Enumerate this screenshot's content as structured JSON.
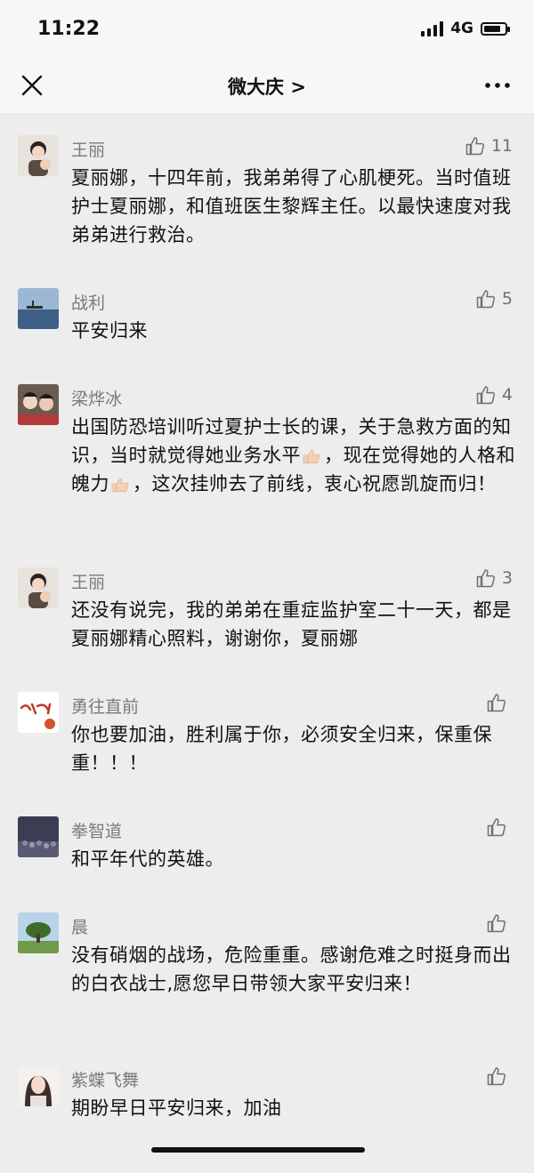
{
  "status": {
    "time": "11:22",
    "network": "4G"
  },
  "nav": {
    "title": "微大庆 >",
    "close_icon": "close-icon",
    "more_icon": "more-icon"
  },
  "comments": [
    {
      "name": "王丽",
      "likes": "11",
      "avatar": "avatar-woman-child",
      "text": "夏丽娜，十四年前，我弟弟得了心肌梗死。当时值班护士夏丽娜，和值班医生黎辉主任。以最快速度对我弟弟进行救治。"
    },
    {
      "name": "战利",
      "likes": "5",
      "avatar": "avatar-seascape",
      "text": "平安归来"
    },
    {
      "name": "梁烨冰",
      "likes": "4",
      "avatar": "avatar-group-photo",
      "text_1": "出国防恐培训听过夏护士长的课，关于急救方面的知识，当时就觉得她业务水平",
      "text_2": "，现在觉得她的人格和魄力",
      "text_3": "，这次挂帅去了前线，衷心祝愿凯旋而归！",
      "emoji": "thumbs-up-emoji"
    },
    {
      "name": "王丽",
      "likes": "3",
      "avatar": "avatar-woman-child",
      "text": "还没有说完，我的弟弟在重症监护室二十一天，都是夏丽娜精心照料，谢谢你，夏丽娜"
    },
    {
      "name": "勇往直前",
      "likes": "",
      "avatar": "avatar-calligraphy",
      "text": "你也要加油，胜利属于你，必须安全归来，保重保重！！！"
    },
    {
      "name": "拳智道",
      "likes": "",
      "avatar": "avatar-crowd",
      "text": "和平年代的英雄。"
    },
    {
      "name": "晨",
      "likes": "",
      "avatar": "avatar-tree",
      "text": "没有硝烟的战场，危险重重。感谢危难之时挺身而出的白衣战士,愿您早日带领大家平安归来！"
    },
    {
      "name": "紫蝶飞舞",
      "likes": "",
      "avatar": "avatar-woman-portrait",
      "text": "期盼早日平安归来，加油"
    }
  ],
  "like_icon": "thumbs-up-icon"
}
